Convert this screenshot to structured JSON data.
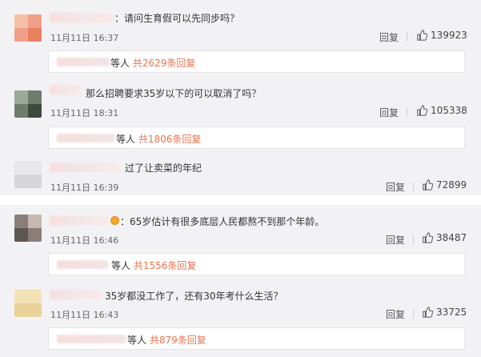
{
  "colors": {
    "panel_bg": "#f2f2f5",
    "accent": "#eb7350",
    "text": "#333333",
    "muted": "#666666"
  },
  "comments": [
    {
      "text": "：请问生育假可以先同步吗？",
      "time": "11月11日 16:37",
      "reply_label": "回复",
      "likes": "139923",
      "subreply": {
        "prefix": "等人",
        "count": "共2629条回复"
      }
    },
    {
      "text": "那么招聘要求35岁以下的可以取消了吗？",
      "time": "11月11日 18:31",
      "reply_label": "回复",
      "likes": "105338",
      "subreply": {
        "prefix": "等人",
        "count": "共1806条回复"
      }
    },
    {
      "text": "过了让卖菜的年纪",
      "time": "11月11日 16:39",
      "reply_label": "回复",
      "likes": "72899"
    },
    {
      "text": "：65岁估计有很多底层人民都熬不到那个年龄。",
      "time": "11月11日 16:46",
      "reply_label": "回复",
      "likes": "38487",
      "subreply": {
        "prefix": "等人",
        "count": "共1556条回复"
      }
    },
    {
      "text": "35岁都没工作了，还有30年考什么生活？",
      "time": "11月11日 16:43",
      "reply_label": "回复",
      "likes": "33725",
      "subreply": {
        "prefix": "等人",
        "count": "共879条回复"
      }
    }
  ],
  "icons": {
    "like": "thumbs-up-icon",
    "badge": "vip-badge-icon"
  }
}
